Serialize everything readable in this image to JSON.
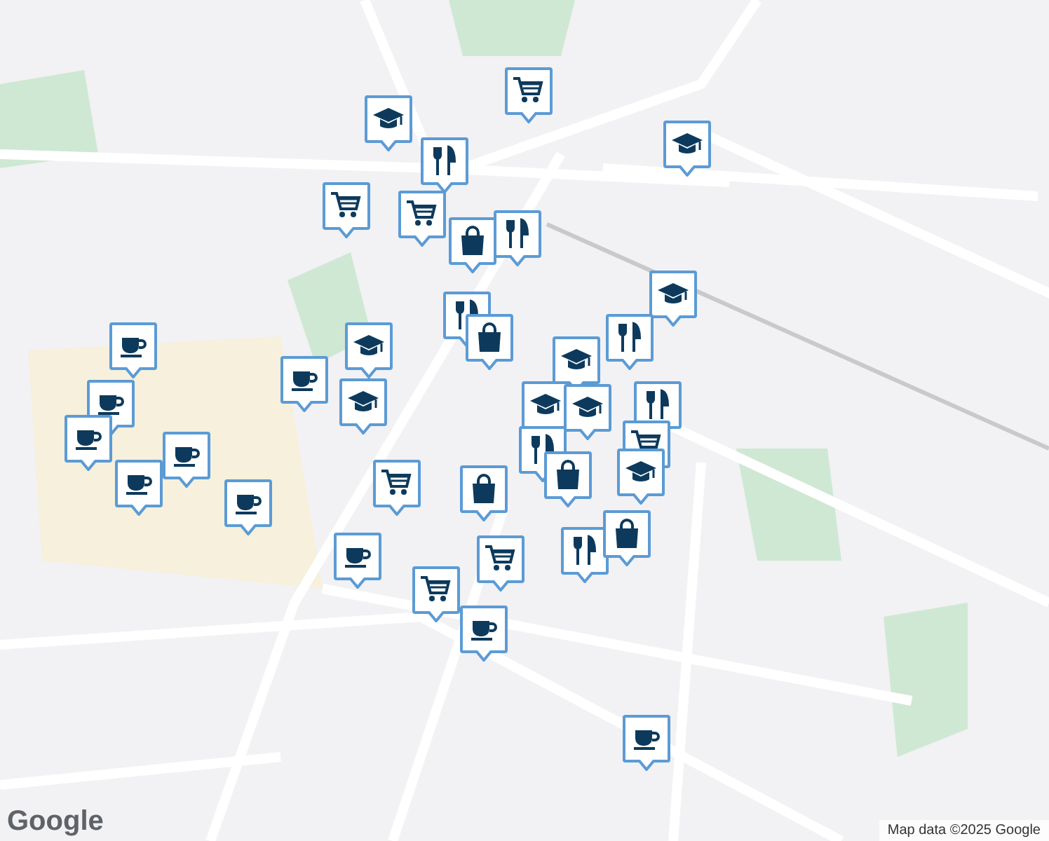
{
  "map": {
    "markers": [
      {
        "kind": "cap"
      },
      {
        "kind": "cart"
      },
      {
        "kind": "cap"
      },
      {
        "kind": "fork"
      },
      {
        "kind": "cart"
      },
      {
        "kind": "cart"
      },
      {
        "kind": "fork"
      },
      {
        "kind": "bag"
      },
      {
        "kind": "cap"
      },
      {
        "kind": "fork"
      },
      {
        "kind": "bag"
      },
      {
        "kind": "fork"
      },
      {
        "kind": "cup"
      },
      {
        "kind": "cap"
      },
      {
        "kind": "cap"
      },
      {
        "kind": "cup"
      },
      {
        "kind": "cup"
      },
      {
        "kind": "cap"
      },
      {
        "kind": "cap"
      },
      {
        "kind": "cap"
      },
      {
        "kind": "fork"
      },
      {
        "kind": "cup"
      },
      {
        "kind": "cup"
      },
      {
        "kind": "cup"
      },
      {
        "kind": "cart"
      },
      {
        "kind": "fork"
      },
      {
        "kind": "cart"
      },
      {
        "kind": "bag"
      },
      {
        "kind": "bag"
      },
      {
        "kind": "cap"
      },
      {
        "kind": "cup"
      },
      {
        "kind": "fork"
      },
      {
        "kind": "bag"
      },
      {
        "kind": "cup"
      },
      {
        "kind": "cart"
      },
      {
        "kind": "cart"
      },
      {
        "kind": "cup"
      },
      {
        "kind": "cup"
      }
    ]
  },
  "logo": "Google",
  "attribution": "Map data ©2025 Google"
}
